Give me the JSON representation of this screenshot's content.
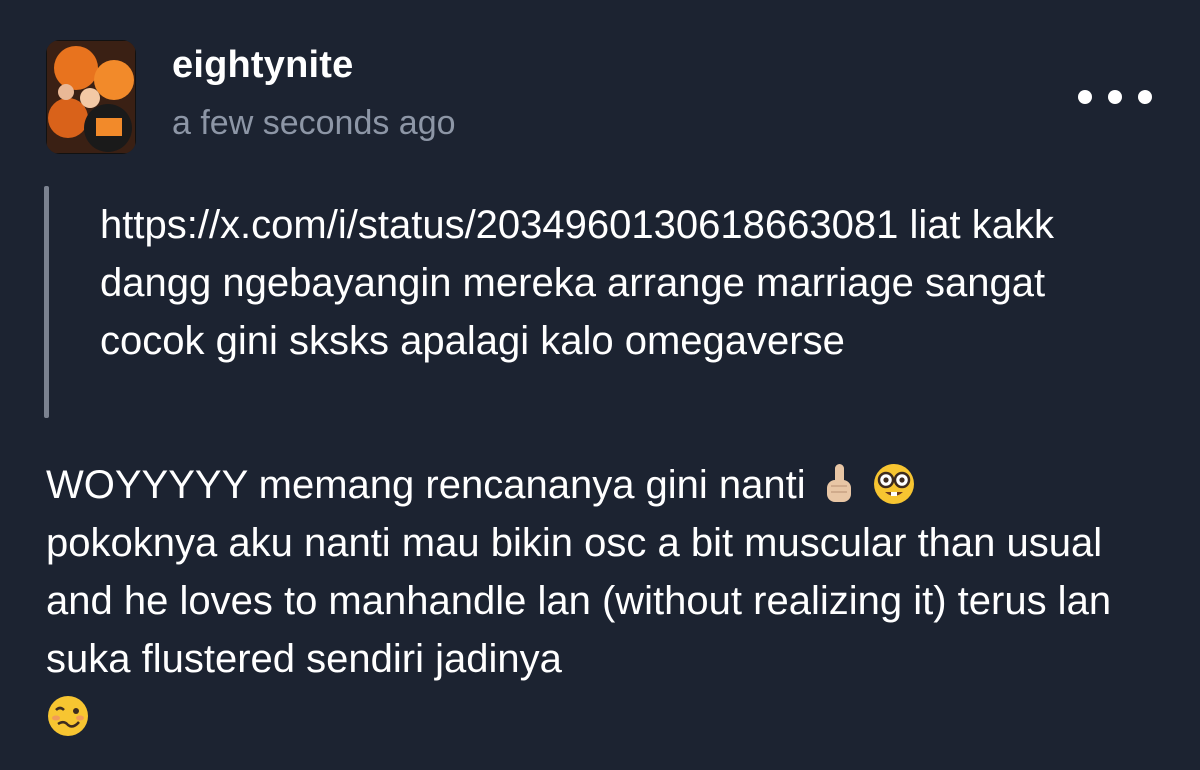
{
  "post": {
    "username": "eightynite",
    "timestamp": "a few seconds ago",
    "quoted_text": "https://x.com/i/status/2034960130618663081 liat kakk dangg ngebayangin mereka arrange marriage sangat cocok gini sksks apalagi kalo omegaverse",
    "reply_line1": "WOYYYYY memang rencananya gini nanti",
    "reply_body": "pokoknya aku nanti mau bikin osc a bit muscular than usual and he loves to manhandle lan (without realizing it) terus lan suka flustered sendiri jadinya"
  },
  "icons": {
    "more": "more-horizontal-icon",
    "emoji_1": "index-pointing-up-light-skin-emoji",
    "emoji_2": "nerd-face-emoji",
    "emoji_3": "woozy-face-emoji"
  },
  "colors": {
    "background": "#1c2331",
    "text": "#ffffff",
    "muted": "#8d96a6",
    "quote_bar": "#7b8290"
  }
}
